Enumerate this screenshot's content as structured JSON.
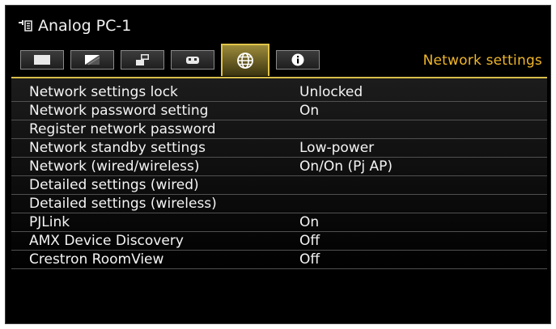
{
  "source": {
    "label": "Analog PC-1"
  },
  "tabs": [
    {
      "icon": "screen-icon"
    },
    {
      "icon": "image-adjust-icon"
    },
    {
      "icon": "installation-icon"
    },
    {
      "icon": "system-settings-icon"
    },
    {
      "icon": "network-globe-icon",
      "active": true
    },
    {
      "icon": "info-icon"
    }
  ],
  "tab_title": "Network settings",
  "colors": {
    "accent": "#f0b62a",
    "highlight_border": "#e1c44a"
  },
  "menu": {
    "items": [
      {
        "label": "Network settings lock",
        "value": "Unlocked"
      },
      {
        "label": "Network password setting",
        "value": "On"
      },
      {
        "label": "Register network password",
        "value": ""
      },
      {
        "label": "Network standby settings",
        "value": "Low-power"
      },
      {
        "label": "Network (wired/wireless)",
        "value": "On/On (Pj AP)"
      },
      {
        "label": "Detailed settings (wired)",
        "value": ""
      },
      {
        "label": "Detailed settings (wireless)",
        "value": ""
      },
      {
        "label": "PJLink",
        "value": "On"
      },
      {
        "label": "AMX Device Discovery",
        "value": "Off"
      },
      {
        "label": "Crestron RoomView",
        "value": "Off"
      }
    ]
  }
}
